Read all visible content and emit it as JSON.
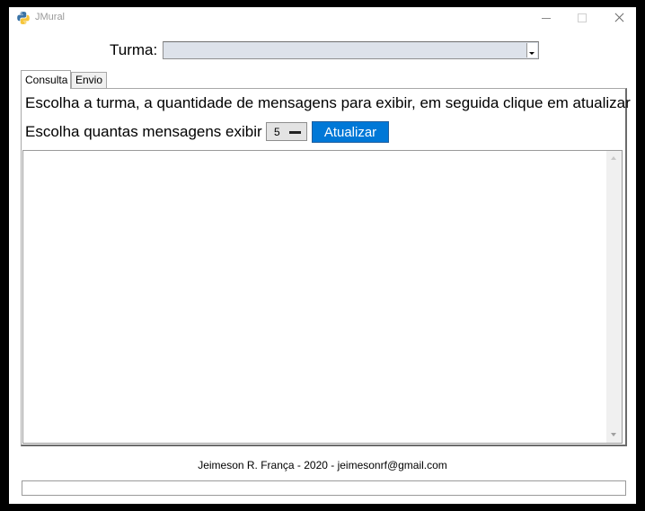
{
  "window": {
    "title": "JMural",
    "app_icon": "python-logo-icon",
    "controls": [
      "minimize-icon",
      "maximize-icon",
      "close-icon"
    ]
  },
  "turma": {
    "label": "Turma:",
    "selected_value": ""
  },
  "tabs": [
    {
      "label": "Consulta",
      "active": true
    },
    {
      "label": "Envio",
      "active": false
    }
  ],
  "consulta": {
    "instruction": "Escolha a turma, a quantidade de mensagens para exibir, em seguida clique em atualizar",
    "count_label": "Escolha quantas mensagens exibir",
    "count_value": "5",
    "update_button": "Atualizar",
    "messages_text": ""
  },
  "footer": {
    "credit": "Jeimeson R. França - 2020 - jeimesonrf@gmail.com",
    "status_text": ""
  },
  "colors": {
    "accent_button": "#0078d7",
    "combo_background": "#dde2ea"
  }
}
